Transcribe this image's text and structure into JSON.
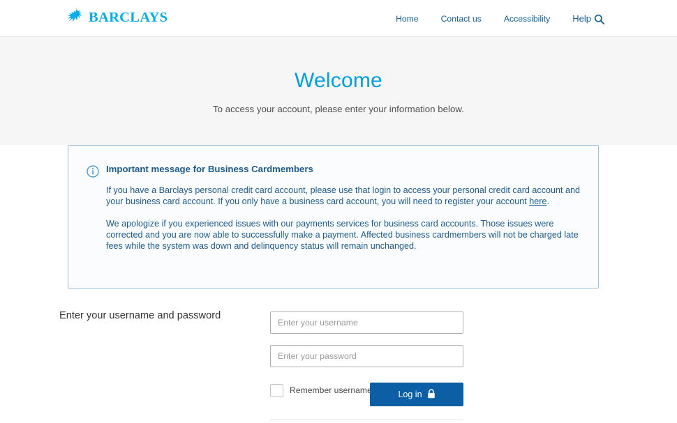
{
  "brand": {
    "name": "BARCLAYS",
    "logo_icon": "barclays-eagle-icon",
    "logo_color": "#00AEEF"
  },
  "header": {
    "nav": [
      {
        "label": "Home",
        "icon": null
      },
      {
        "label": "Contact us",
        "icon": null
      },
      {
        "label": "Accessibility",
        "icon": null
      },
      {
        "label": "Help",
        "icon": "search-icon"
      }
    ],
    "link_color": "#12619c"
  },
  "hero": {
    "title": "Welcome",
    "subtitle": "To access your account, please enter your information below.",
    "title_color": "#00A0E1",
    "background": "#f6f6f6"
  },
  "info_message": {
    "icon": "info-circle-icon",
    "title": "Important message for Business Cardmembers",
    "paragraph_1_before_link": "If you have a Barclays personal credit card account, please use that login to access your personal credit card account and your business card account. If you only have a business card account, you will need to register your account ",
    "link_text": "here",
    "paragraph_1_after_link": ".",
    "paragraph_2": "We apologize if you experienced issues with our payments services for business card accounts. Those issues were corrected and you are now able to successfully make a payment. Affected business cardmembers will not be charged late fees while the system was down and delinquency status will remain unchanged.",
    "border_color": "#9cc0dd",
    "background": "#fafcfe",
    "text_color": "#1b5b8f"
  },
  "login_form": {
    "section_label": "Enter your username and password",
    "username": {
      "value": "",
      "placeholder": "Enter your username"
    },
    "password": {
      "value": "",
      "placeholder": "Enter your password"
    },
    "remember": {
      "label": "Remember username",
      "checked": false
    },
    "submit": {
      "label": "Log in",
      "icon": "padlock-icon",
      "color": "#0c5fa5"
    }
  }
}
